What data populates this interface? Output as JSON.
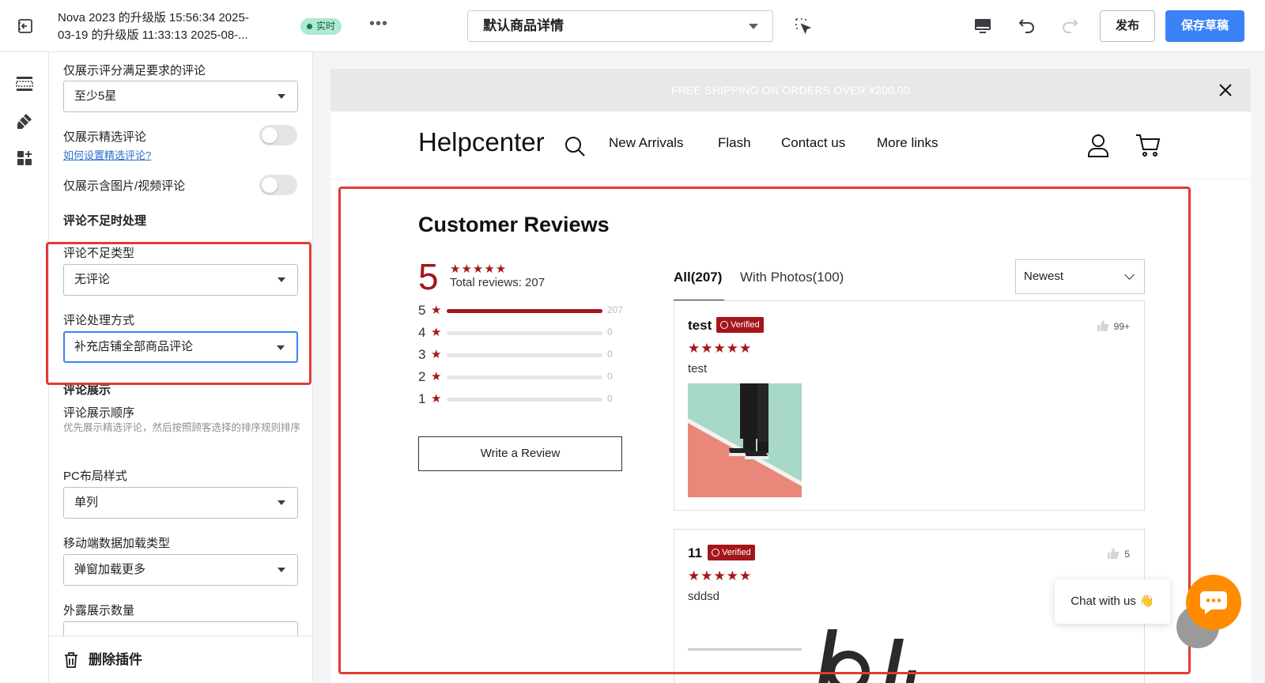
{
  "topbar": {
    "title_line1": "Nova 2023 的升级版 15:56:34 2025-",
    "title_line2": "03-19 的升级版 11:33:13 2025-08-...",
    "status_badge": "实时",
    "page_select": "默认商品详情",
    "publish_label": "发布",
    "save_draft_label": "保存草稿"
  },
  "panel": {
    "rating_filter_label": "仅展示评分满足要求的评论",
    "rating_filter_value": "至少5星",
    "featured_only_label": "仅展示精选评论",
    "featured_help_link": "如何设置精选评论?",
    "media_only_label": "仅展示含图片/视频评论",
    "insufficient_heading": "评论不足时处理",
    "insufficient_type_label": "评论不足类型",
    "insufficient_type_value": "无评论",
    "handling_label": "评论处理方式",
    "handling_value": "补充店铺全部商品评论",
    "display_heading": "评论展示",
    "order_label": "评论展示顺序",
    "order_hint": "优先展示精选评论，然后按照顾客选择的排序规则排序",
    "pc_layout_label": "PC布局样式",
    "pc_layout_value": "单列",
    "mobile_load_label": "移动端数据加载类型",
    "mobile_load_value": "弹窗加载更多",
    "exposed_count_label": "外露展示数量",
    "delete_label": "删除插件"
  },
  "preview": {
    "announcement": "FREE SHIPPING ON ORDERS OVER ¥200.00",
    "logo": "Helpcenter",
    "nav": [
      "New Arrivals",
      "Flash",
      "Contact us",
      "More links"
    ],
    "reviews_title": "Customer Reviews",
    "score": "5",
    "stars": "★★★★★",
    "total_reviews": "Total reviews: 207",
    "distribution": [
      {
        "stars": "5",
        "count": "207",
        "fraction": 1.0
      },
      {
        "stars": "4",
        "count": "0",
        "fraction": 0
      },
      {
        "stars": "3",
        "count": "0",
        "fraction": 0
      },
      {
        "stars": "2",
        "count": "0",
        "fraction": 0
      },
      {
        "stars": "1",
        "count": "0",
        "fraction": 0
      }
    ],
    "write_review": "Write a Review",
    "tab_all": "All(207)",
    "tab_photos": "With Photos(100)",
    "sort_value": "Newest",
    "reviews": [
      {
        "author": "test",
        "badge": "Verified",
        "likes": "99+",
        "stars": "★★★★★",
        "text": "test"
      },
      {
        "author": "11",
        "badge": "Verified",
        "likes": "5",
        "stars": "★★★★★",
        "text": "sddsd"
      }
    ]
  },
  "chat": {
    "label": "Chat with us 👋"
  },
  "colors": {
    "primary_button": "#3b82f6",
    "review_accent": "#a4161a",
    "highlight_border": "#e53935",
    "chat_launcher": "#ff8c00"
  },
  "icons": [
    "exit-icon",
    "more-icon",
    "select-element-icon",
    "desktop-icon",
    "undo-icon",
    "redo-icon",
    "sections-icon",
    "theme-brush-icon",
    "apps-icon",
    "trash-icon",
    "close-icon",
    "search-icon",
    "user-icon",
    "cart-icon",
    "thumbs-up-icon",
    "chat-icon"
  ]
}
